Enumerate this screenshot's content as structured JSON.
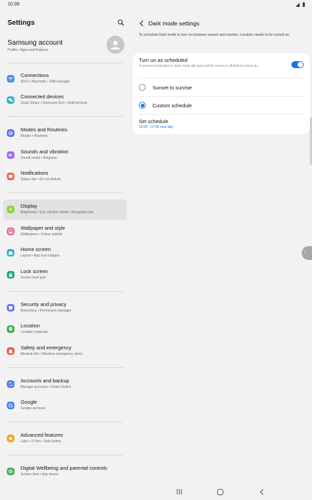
{
  "status": {
    "time": "10.00",
    "icons": "signal-icon battery-icon"
  },
  "left": {
    "title": "Settings",
    "account": {
      "name": "Samsung account",
      "sub": "Profile • Apps and features"
    },
    "items": [
      {
        "title": "Connections",
        "sub": "Wi-Fi • Bluetooth • SIM manager",
        "color": "#3d8ff5",
        "icon": "wifi-icon"
      },
      {
        "title": "Connected devices",
        "sub": "Quick Share • Samsung DeX • Android Auto",
        "color": "#27b5c9",
        "icon": "devices-icon"
      },
      {
        "title": "Modes and Routines",
        "sub": "Modes • Routines",
        "color": "#5b6cf0",
        "icon": "routine-icon"
      },
      {
        "title": "Sounds and vibration",
        "sub": "Sound mode • Ringtone",
        "color": "#9a6ef0",
        "icon": "sound-icon"
      },
      {
        "title": "Notifications",
        "sub": "Status bar • Do not disturb",
        "color": "#f0634f",
        "icon": "bell-icon"
      },
      {
        "title": "Display",
        "sub": "Brightness • Eye comfort shield • Navigation bar",
        "color": "#86d43a",
        "icon": "sun-icon"
      },
      {
        "title": "Wallpaper and style",
        "sub": "Wallpapers • Colour palette",
        "color": "#e85a9a",
        "icon": "wallpaper-icon"
      },
      {
        "title": "Home screen",
        "sub": "Layout • App icon badges",
        "color": "#2bb6d4",
        "icon": "home-icon"
      },
      {
        "title": "Lock screen",
        "sub": "Screen lock type",
        "color": "#19a57c",
        "icon": "lock-icon"
      },
      {
        "title": "Security and privacy",
        "sub": "Biometrics • Permission manager",
        "color": "#6a72f2",
        "icon": "shield-icon"
      },
      {
        "title": "Location",
        "sub": "Location requests",
        "color": "#3cb04a",
        "icon": "location-icon"
      },
      {
        "title": "Safety and emergency",
        "sub": "Medical info • Wireless emergency alerts",
        "color": "#e8584c",
        "icon": "alert-icon"
      },
      {
        "title": "Accounts and backup",
        "sub": "Manage accounts • Smart Switch",
        "color": "#4c78ee",
        "icon": "sync-icon"
      },
      {
        "title": "Google",
        "sub": "Google services",
        "color": "#3f7ff2",
        "icon": "google-icon"
      },
      {
        "title": "Advanced features",
        "sub": "Labs • S Pen • Side button",
        "color": "#f2a51f",
        "icon": "star-icon"
      },
      {
        "title": "Digital Wellbeing and parental controls",
        "sub": "Screen time • App timers",
        "color": "#39b24c",
        "icon": "wellbeing-icon"
      }
    ]
  },
  "right": {
    "title": "Dark mode settings",
    "description": "To schedule Dark mode to turn on between sunset and sunrise, Location needs to be turned on.",
    "scheduled": {
      "title": "Turn on as scheduled",
      "desc": "To prevent interruptions, Dark mode will wait until the screen is off before it turns on.",
      "enabled": true
    },
    "options": [
      {
        "label": "Sunset to sunrise",
        "selected": false
      },
      {
        "label": "Custom schedule",
        "selected": true
      }
    ],
    "schedule": {
      "title": "Set schedule",
      "value": "19:00 - 07:00 next day"
    }
  },
  "colors": {
    "accent": "#1a73e8",
    "background": "#f2f2f2",
    "card": "#ffffff"
  }
}
